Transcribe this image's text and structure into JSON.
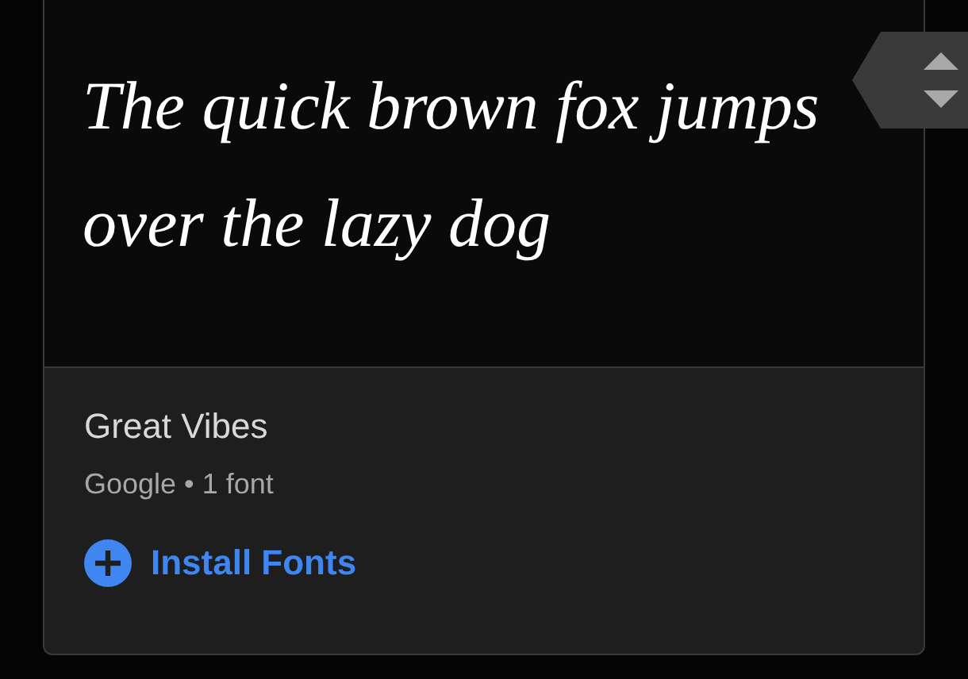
{
  "font_card": {
    "preview_text": "The quick brown fox jumps over the lazy dog",
    "font_name": "Great Vibes",
    "meta": "Google • 1 font",
    "install_button": {
      "label": "Install Fonts"
    }
  }
}
